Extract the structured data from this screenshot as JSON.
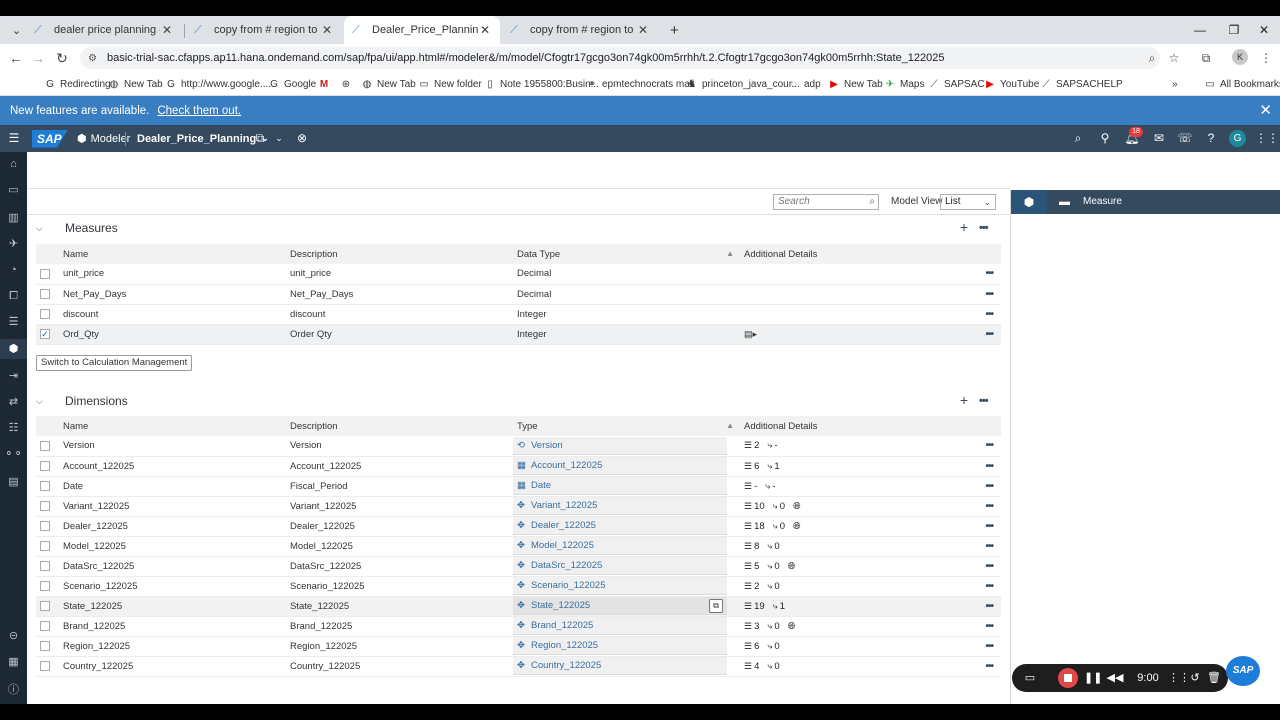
{
  "browser": {
    "tabs": [
      {
        "title": "dealer price planning - Stories"
      },
      {
        "title": "copy from # region to regions"
      },
      {
        "title": "Dealer_Price_Planning - Modeler"
      },
      {
        "title": "copy from # region to regions"
      }
    ],
    "url": "basic-trial-sac.cfapps.ap11.hana.ondemand.com/sap/fpa/ui/app.html#/modeler&/m/model/Cfogtr17gcgo3on74gk00m5rrhh/t.2.Cfogtr17gcgo3on74gk00m5rrhh:State_122025",
    "profile_initial": "K",
    "bookmarks": [
      "Redirecting",
      "New Tab",
      "http://www.google....",
      "Google",
      "",
      "",
      "New Tab",
      "New folder",
      "Note 1955800:Busin...",
      "epmtechnocrats mail",
      "princeton_java_cour...",
      "adp",
      "New Tab",
      "Maps",
      "SAPSAC",
      "YouTube",
      "SAPSACHELP"
    ],
    "all_bookmarks": "All Bookmarks"
  },
  "notification": {
    "text": "New features are available.",
    "link": "Check them out."
  },
  "shell": {
    "logo": "SAP",
    "app": "Modeler",
    "model_name": "Dealer_Price_Planning",
    "notification_count": "18",
    "user_initial": "G"
  },
  "toolbar": {
    "search_placeholder": "Search",
    "model_view_label": "Model View",
    "model_view_value": "List"
  },
  "measures": {
    "title": "Measures",
    "columns": [
      "Name",
      "Description",
      "Data Type",
      "Additional Details"
    ],
    "rows": [
      {
        "name": "unit_price",
        "description": "unit_price",
        "type": "Decimal",
        "checked": false
      },
      {
        "name": "Net_Pay_Days",
        "description": "Net_Pay_Days",
        "type": "Decimal",
        "checked": false
      },
      {
        "name": "discount",
        "description": "discount",
        "type": "Integer",
        "checked": false
      },
      {
        "name": "Ord_Qty",
        "description": "Order Qty",
        "type": "Integer",
        "checked": true
      }
    ],
    "calc_button": "Switch to Calculation Management"
  },
  "dimensions": {
    "title": "Dimensions",
    "columns": [
      "Name",
      "Description",
      "Type",
      "Additional Details"
    ],
    "rows": [
      {
        "name": "Version",
        "description": "Version",
        "type": "Version",
        "icon": "version-icon",
        "members": "2",
        "hier": "-",
        "globe": false
      },
      {
        "name": "Account_122025",
        "description": "Account_122025",
        "type": "Account_122025",
        "icon": "account-icon",
        "members": "6",
        "hier": "1",
        "globe": false
      },
      {
        "name": "Date",
        "description": "Fiscal_Period",
        "type": "Date",
        "icon": "calendar-icon",
        "members": "-",
        "hier": "-",
        "globe": false
      },
      {
        "name": "Variant_122025",
        "description": "Variant_122025",
        "type": "Variant_122025",
        "icon": "generic-dim-icon",
        "members": "10",
        "hier": "0",
        "globe": true
      },
      {
        "name": "Dealer_122025",
        "description": "Dealer_122025",
        "type": "Dealer_122025",
        "icon": "generic-dim-icon",
        "members": "18",
        "hier": "0",
        "globe": true
      },
      {
        "name": "Model_122025",
        "description": "Model_122025",
        "type": "Model_122025",
        "icon": "generic-dim-icon",
        "members": "8",
        "hier": "0",
        "globe": false
      },
      {
        "name": "DataSrc_122025",
        "description": "DataSrc_122025",
        "type": "DataSrc_122025",
        "icon": "generic-dim-icon",
        "members": "5",
        "hier": "0",
        "globe": true
      },
      {
        "name": "Scenario_122025",
        "description": "Scenario_122025",
        "type": "Scenario_122025",
        "icon": "generic-dim-icon",
        "members": "2",
        "hier": "0",
        "globe": false
      },
      {
        "name": "State_122025",
        "description": "State_122025",
        "type": "State_122025",
        "icon": "generic-dim-icon",
        "members": "19",
        "hier": "1",
        "globe": false,
        "hover": true
      },
      {
        "name": "Brand_122025",
        "description": "Brand_122025",
        "type": "Brand_122025",
        "icon": "generic-dim-icon",
        "members": "3",
        "hier": "0",
        "globe": true
      },
      {
        "name": "Region_122025",
        "description": "Region_122025",
        "type": "Region_122025",
        "icon": "generic-dim-icon",
        "members": "6",
        "hier": "0",
        "globe": false
      },
      {
        "name": "Country_122025",
        "description": "Country_122025",
        "type": "Country_122025",
        "icon": "generic-dim-icon",
        "members": "4",
        "hier": "0",
        "globe": false
      }
    ]
  },
  "right_panel": {
    "title": "Measure"
  },
  "recorder": {
    "time": "9:00"
  },
  "help_logo": "SAP"
}
